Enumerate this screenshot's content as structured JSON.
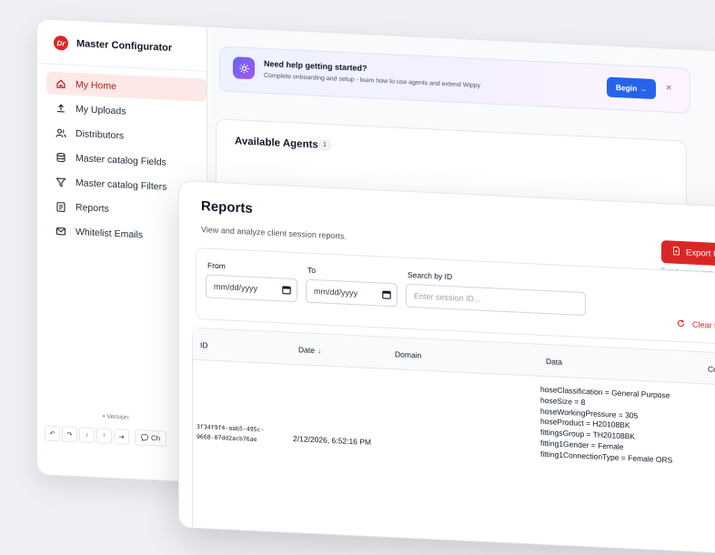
{
  "app": {
    "brand_logo": "Dr",
    "brand_name": "Master Configurator",
    "accent_color": "#dc2626"
  },
  "sidebar": {
    "items": [
      {
        "label": "My Home",
        "icon": "home-icon",
        "active": true
      },
      {
        "label": "My Uploads",
        "icon": "upload-icon",
        "active": false
      },
      {
        "label": "Distributors",
        "icon": "users-icon",
        "active": false
      },
      {
        "label": "Master catalog Fields",
        "icon": "database-icon",
        "active": false
      },
      {
        "label": "Master catalog Filters",
        "icon": "filter-icon",
        "active": false
      },
      {
        "label": "Reports",
        "icon": "report-icon",
        "active": false
      },
      {
        "label": "Whitelist Emails",
        "icon": "mail-icon",
        "active": false
      }
    ],
    "version_label": "• Version:",
    "bottom": {
      "undo": "↶",
      "redo": "↷",
      "download": "↓",
      "upload": "↑",
      "logout": "⇥",
      "chat_label": "Ch"
    }
  },
  "banner": {
    "title": "Need help getting started?",
    "subtitle": "Complete onboarding and setup - learn how to use agents and extend Wippy",
    "begin_label": "Begin →",
    "close": "×"
  },
  "agents": {
    "title": "Available Agents",
    "count": "1"
  },
  "reports": {
    "title": "Reports",
    "subtitle": "View and analyze client session reports.",
    "export_label": "Export to",
    "export_note": "Export uses current",
    "filters": {
      "from_label": "From",
      "from_value": "mm/dd/yyyy",
      "to_label": "To",
      "to_value": "mm/dd/yyyy",
      "search_label": "Search by ID",
      "search_placeholder": "Enter session ID...",
      "clear_label": "Clear f"
    },
    "columns": [
      "ID",
      "Date",
      "Domain",
      "Data",
      "Co"
    ],
    "sort_indicator": "↓",
    "rows": [
      {
        "id_line1": "3f34f9f4-aab5-495c-",
        "id_line2": "9668-07dd2acb76ae",
        "date": "2/12/2026, 6:52:16 PM",
        "data": [
          "hoseClassification = General Purpose",
          "hoseSize = 8",
          "hoseWorkingPressure = 305",
          "hoseProduct = H20108BK",
          "fittingsGroup = TH20108BK",
          "fitting1Gender = Female",
          "fitting1ConnectionType = Female ORS"
        ]
      }
    ]
  }
}
